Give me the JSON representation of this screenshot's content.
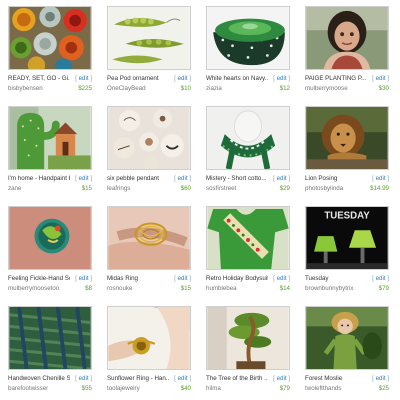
{
  "edit_label": "edit",
  "items": [
    {
      "title": "READY, SET, GO - Gi...",
      "seller": "bisbybensen",
      "price": "$225",
      "thumb": "buttons-icon"
    },
    {
      "title": "Pea Pod ornament",
      "seller": "OneClayBead",
      "price": "$10",
      "thumb": "pea-pod-icon"
    },
    {
      "title": "White hearts on Navy...",
      "seller": "ziazia",
      "price": "$12",
      "thumb": "pouch-icon"
    },
    {
      "title": "PAIGE PLANTING P...",
      "seller": "mulberrymoose",
      "price": "$30",
      "thumb": "doll-icon"
    },
    {
      "title": "I'm home - Handpaint b...",
      "seller": "zane",
      "price": "$15",
      "thumb": "cactus-house-icon"
    },
    {
      "title": "six pebble pendant",
      "seller": "leafrings",
      "price": "$60",
      "thumb": "pebbles-icon"
    },
    {
      "title": "Mistery  - Short cotto...",
      "seller": "sosfirstreet",
      "price": "$29",
      "thumb": "scarf-icon"
    },
    {
      "title": "Lion Posing",
      "seller": "photosbylinda",
      "price": "$14.99",
      "thumb": "lion-icon"
    },
    {
      "title": "Feeling Fickle-Hand Sc...",
      "seller": "mulberrymoosetoo",
      "price": "$8",
      "thumb": "ring-disc-icon"
    },
    {
      "title": "Midas Ring",
      "seller": "rosnouke",
      "price": "$15",
      "thumb": "gold-ring-icon"
    },
    {
      "title": "Retro Holiday Bodysuit",
      "seller": "humblebea",
      "price": "$14",
      "thumb": "bodysuit-icon"
    },
    {
      "title": "Tuesday",
      "seller": "brownbunnybytrix",
      "price": "$79",
      "thumb": "tuesday-lamps-icon",
      "thumb_text": "TUESDAY"
    },
    {
      "title": "Handwoven Chenille Scarf",
      "seller": "barefootwisser",
      "price": "$55",
      "thumb": "chenille-scarf-icon"
    },
    {
      "title": "Sunflower Ring - Han...",
      "seller": "toolajewelry",
      "price": "$40",
      "thumb": "sunflower-ring-icon"
    },
    {
      "title": "The Tree of the Birth ...",
      "seller": "hilma",
      "price": "$79",
      "thumb": "bonsai-tree-icon"
    },
    {
      "title": "Forest Moslie",
      "seller": "twoleftthands",
      "price": "$25",
      "thumb": "forest-doll-icon"
    }
  ]
}
